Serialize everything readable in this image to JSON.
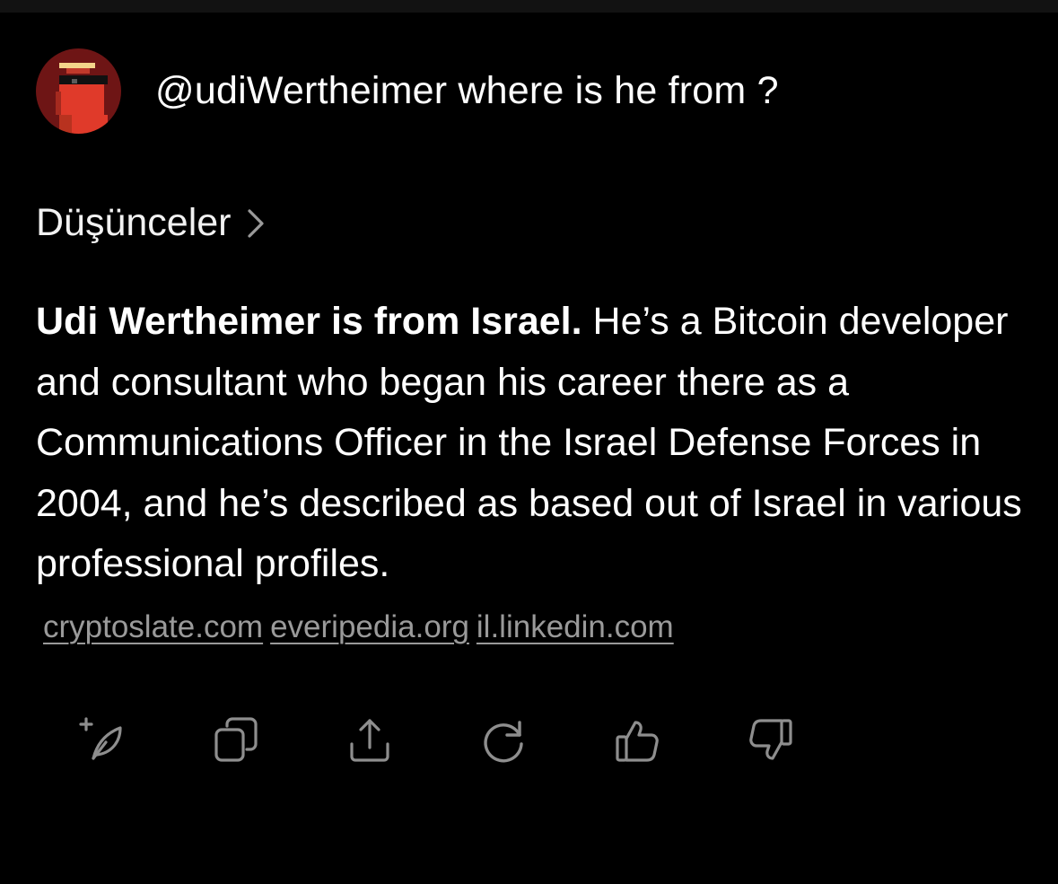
{
  "user": {
    "avatar_icon": "pixel-art-avatar-icon",
    "message": "@udiWertheimer where is he from ?"
  },
  "thoughts": {
    "label": "Düşünceler",
    "icon": "chevron-right-icon"
  },
  "answer": {
    "bold_lead": "Udi Wertheimer is from Israel.",
    "text": " He’s a Bitcoin developer and consultant who began his career there as a Communications Officer in the Israel Defense Forces in 2004, and he’s described as based out of Israel in various professional profiles.",
    "sources": [
      "cryptoslate.com",
      "everipedia.org",
      "il.linkedin.com"
    ]
  },
  "actions": [
    {
      "icon": "add-to-note-icon"
    },
    {
      "icon": "copy-icon"
    },
    {
      "icon": "share-icon"
    },
    {
      "icon": "regenerate-icon"
    },
    {
      "icon": "thumbs-up-icon"
    },
    {
      "icon": "thumbs-down-icon"
    }
  ],
  "colors": {
    "background": "#000000",
    "text": "#ffffff",
    "muted": "#9a9a9a",
    "icon": "#8e8e8e",
    "avatar_bg": "#7a1414",
    "avatar_accent": "#e03a2a"
  }
}
